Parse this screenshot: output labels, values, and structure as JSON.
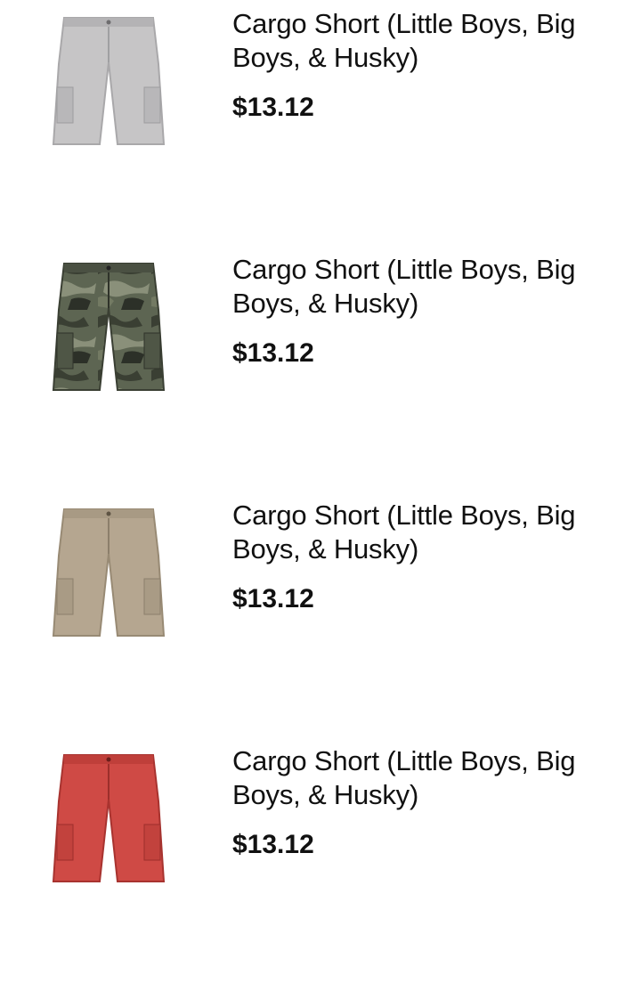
{
  "products": [
    {
      "title": "Cargo Short (Little Boys, Big Boys, & Husky)",
      "price": "$13.12",
      "image": "gray-cargo-shorts",
      "color": "#c6c5c6"
    },
    {
      "title": "Cargo Short (Little Boys, Big Boys, & Husky)",
      "price": "$13.12",
      "image": "camo-cargo-shorts",
      "color": "#5d6552"
    },
    {
      "title": "Cargo Short (Little Boys, Big Boys, & Husky)",
      "price": "$13.12",
      "image": "khaki-cargo-shorts",
      "color": "#b5a690"
    },
    {
      "title": "Cargo Short (Little Boys, Big Boys, & Husky)",
      "price": "$13.12",
      "image": "red-cargo-shorts",
      "color": "#cf4a45"
    }
  ]
}
